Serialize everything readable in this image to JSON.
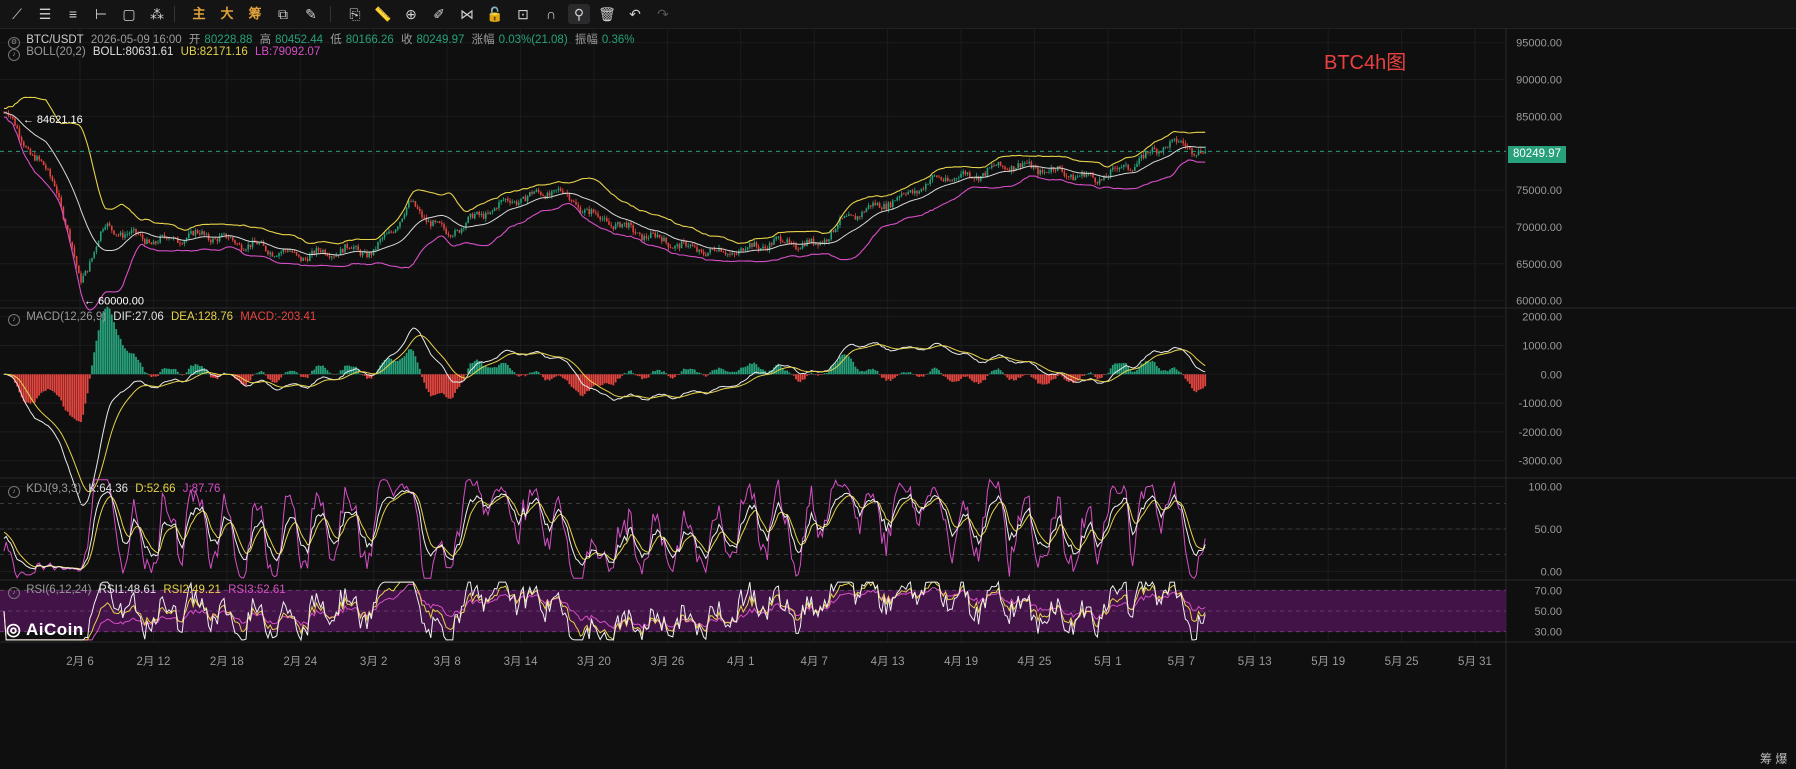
{
  "toolbar": {
    "tools": [
      {
        "icon": "trendline-icon",
        "glyph": "⟋"
      },
      {
        "icon": "horizontal-lines-icon",
        "glyph": "☰"
      },
      {
        "icon": "parallel-lines-icon",
        "glyph": "≡"
      },
      {
        "icon": "ray-line-icon",
        "glyph": "⊢"
      },
      {
        "icon": "rectangle-icon",
        "glyph": "▢"
      },
      {
        "icon": "dots-pattern-icon",
        "glyph": "⁂"
      },
      {
        "icon": "main-chart-label",
        "glyph": "主",
        "cn": true
      },
      {
        "icon": "large-label",
        "glyph": "大",
        "cn": true
      },
      {
        "icon": "chips-label",
        "glyph": "筹",
        "cn": true
      },
      {
        "icon": "layers-icon",
        "glyph": "⧉"
      },
      {
        "icon": "pen-icon",
        "glyph": "✎"
      },
      {
        "icon": "copy-icon",
        "glyph": "⎘"
      },
      {
        "icon": "ruler-icon",
        "glyph": "📏"
      },
      {
        "icon": "zoom-alert-icon",
        "glyph": "⊕"
      },
      {
        "icon": "brush-icon",
        "glyph": "✐"
      },
      {
        "icon": "pattern-icon",
        "glyph": "⋈"
      },
      {
        "icon": "lock-icon",
        "glyph": "🔓"
      },
      {
        "icon": "eye-edit-icon",
        "glyph": "⊡"
      },
      {
        "icon": "magnet-icon",
        "glyph": "∩"
      },
      {
        "icon": "filter-icon",
        "glyph": "⚲",
        "active": true
      },
      {
        "icon": "trash-icon",
        "glyph": "🗑"
      },
      {
        "icon": "undo-icon",
        "glyph": "↶"
      },
      {
        "icon": "redo-icon",
        "glyph": "↷",
        "dim": true
      }
    ]
  },
  "header": {
    "symbol": "BTC/USDT",
    "datetime": "2026-05-09 16:00",
    "open_label": "开",
    "open": "80228.88",
    "high_label": "高",
    "high": "80452.44",
    "low_label": "低",
    "low": "80166.26",
    "close_label": "收",
    "close": "80249.97",
    "change_label": "涨幅",
    "change": "0.03%(21.08)",
    "amp_label": "振幅",
    "amp": "0.36%"
  },
  "boll": {
    "name": "BOLL(20,2)",
    "mid": "BOLL:80631.61",
    "ub": "UB:82171.16",
    "lb": "LB:79092.07"
  },
  "macd": {
    "name": "MACD(12,26,9)",
    "dif": "DIF:27.06",
    "dea": "DEA:128.76",
    "macd": "MACD:-203.41"
  },
  "kdj": {
    "name": "KDJ(9,3,3)",
    "k": "K:64.36",
    "d": "D:52.66",
    "j": "J:87.76"
  },
  "rsi": {
    "name": "RSI(6,12,24)",
    "rsi1": "RSI1:48.61",
    "rsi2": "RSI2:49.21",
    "rsi3": "RSI3:52.61"
  },
  "title_label": "BTC4h图",
  "brand": "AiCoin",
  "corner_labels": "筹 爆",
  "current_price": "80249.97",
  "colors": {
    "up": "#26a17b",
    "down": "#e5453f",
    "boll_ub": "#e6d24a",
    "boll_mid": "#d8d8d8",
    "boll_lb": "#d64fc5",
    "kdj_k": "#f0f0f0",
    "kdj_d": "#e6d24a",
    "kdj_j": "#d64fc5",
    "rsi_band": "#4a1450",
    "accent_red": "#e8413f"
  },
  "chart_data": [
    {
      "type": "candlestick",
      "name": "price",
      "y_ticks": [
        "95000.00",
        "90000.00",
        "85000.00",
        "80000.00",
        "75000.00",
        "70000.00",
        "65000.00",
        "60000.00"
      ],
      "ylim": [
        59000,
        97000
      ],
      "annotations": [
        {
          "text": "84621.16",
          "value": 84621.16,
          "date": "2026-02-01"
        },
        {
          "text": "60000.00",
          "value": 60000,
          "date": "2026-02-06"
        }
      ],
      "last_price": 80249.97,
      "keypoints": [
        [
          "2026-01-31",
          85500
        ],
        [
          "2026-02-02",
          80000
        ],
        [
          "2026-02-04",
          76000
        ],
        [
          "2026-02-06",
          62500
        ],
        [
          "2026-02-08",
          70000
        ],
        [
          "2026-02-12",
          68000
        ],
        [
          "2026-02-16",
          69000
        ],
        [
          "2026-02-20",
          67500
        ],
        [
          "2026-02-24",
          66000
        ],
        [
          "2026-02-28",
          67000
        ],
        [
          "2026-03-02",
          66500
        ],
        [
          "2026-03-05",
          73000
        ],
        [
          "2026-03-08",
          69000
        ],
        [
          "2026-03-10",
          71000
        ],
        [
          "2026-03-13",
          73500
        ],
        [
          "2026-03-17",
          75000
        ],
        [
          "2026-03-20",
          71500
        ],
        [
          "2026-03-24",
          69000
        ],
        [
          "2026-03-28",
          67000
        ],
        [
          "2026-03-31",
          66500
        ],
        [
          "2026-04-04",
          68000
        ],
        [
          "2026-04-07",
          67500
        ],
        [
          "2026-04-10",
          71500
        ],
        [
          "2026-04-14",
          74000
        ],
        [
          "2026-04-17",
          76500
        ],
        [
          "2026-04-20",
          77000
        ],
        [
          "2026-04-23",
          78500
        ],
        [
          "2026-04-27",
          77500
        ],
        [
          "2026-04-30",
          76500
        ],
        [
          "2026-05-03",
          78500
        ],
        [
          "2026-05-06",
          81500
        ],
        [
          "2026-05-09",
          80250
        ]
      ]
    },
    {
      "type": "line",
      "name": "MACD(12,26,9)",
      "y_ticks": [
        "2000.00",
        "1000.00",
        "0.00",
        "-1000.00",
        "-2000.00",
        "-3000.00"
      ],
      "ylim": [
        -3600,
        2300
      ]
    },
    {
      "type": "line",
      "name": "KDJ(9,3,3)",
      "y_ticks": [
        "100.00",
        "50.00",
        "0.00"
      ],
      "ylim": [
        -10,
        110
      ]
    },
    {
      "type": "line",
      "name": "RSI(6,12,24)",
      "y_ticks": [
        "70.00",
        "50.00",
        "30.00"
      ],
      "ylim": [
        20,
        80
      ]
    }
  ],
  "x_ticks": [
    {
      "label": "2月 6",
      "date": "2026-02-06"
    },
    {
      "label": "2月 12",
      "date": "2026-02-12"
    },
    {
      "label": "2月 18",
      "date": "2026-02-18"
    },
    {
      "label": "2月 24",
      "date": "2026-02-24"
    },
    {
      "label": "3月 2",
      "date": "2026-03-02"
    },
    {
      "label": "3月 8",
      "date": "2026-03-08"
    },
    {
      "label": "3月 14",
      "date": "2026-03-14"
    },
    {
      "label": "3月 20",
      "date": "2026-03-20"
    },
    {
      "label": "3月 26",
      "date": "2026-03-26"
    },
    {
      "label": "4月 1",
      "date": "2026-04-01"
    },
    {
      "label": "4月 7",
      "date": "2026-04-07"
    },
    {
      "label": "4月 13",
      "date": "2026-04-13"
    },
    {
      "label": "4月 19",
      "date": "2026-04-19"
    },
    {
      "label": "4月 25",
      "date": "2026-04-25"
    },
    {
      "label": "5月 1",
      "date": "2026-05-01"
    },
    {
      "label": "5月 7",
      "date": "2026-05-07"
    },
    {
      "label": "5月 13",
      "date": "2026-05-13"
    },
    {
      "label": "5月 19",
      "date": "2026-05-19"
    },
    {
      "label": "5月 25",
      "date": "2026-05-25"
    },
    {
      "label": "5月 31",
      "date": "2026-05-31"
    }
  ]
}
